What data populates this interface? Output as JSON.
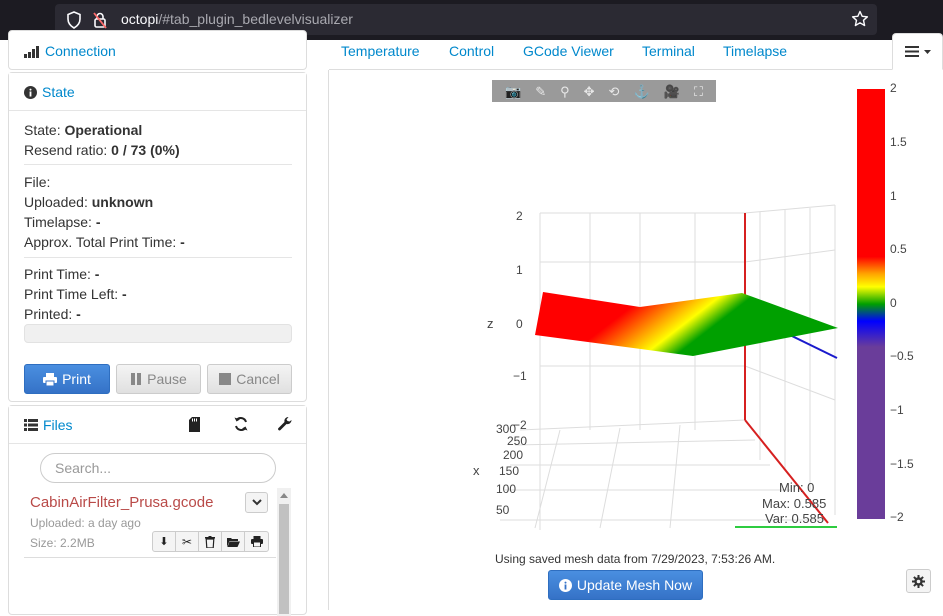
{
  "browser": {
    "url_host": "octopi",
    "url_path": "/#tab_plugin_bedlevelvisualizer"
  },
  "connection": {
    "label": "Connection"
  },
  "state": {
    "title": "State",
    "state_label": "State: ",
    "state_value": "Operational",
    "resend_label": "Resend ratio: ",
    "resend_value": "0 / 73 (0%)",
    "file_label": "File:",
    "uploaded_label": "Uploaded: ",
    "uploaded_value": "unknown",
    "timelapse_label": "Timelapse: ",
    "timelapse_value": "-",
    "approx_label": "Approx. Total Print Time: ",
    "approx_value": "-",
    "print_time_label": "Print Time: ",
    "print_time_value": "-",
    "print_time_left_label": "Print Time Left: ",
    "print_time_left_value": "-",
    "printed_label": "Printed: ",
    "printed_value": "-",
    "progress": 0,
    "buttons": {
      "print": "Print",
      "pause": "Pause",
      "cancel": "Cancel"
    }
  },
  "files": {
    "title": "Files",
    "search_placeholder": "Search...",
    "items": [
      {
        "name": "CabinAirFilter_Prusa.gcode",
        "uploaded": "Uploaded: a day ago",
        "size": "Size: 2.2MB"
      }
    ]
  },
  "tabs": [
    "Temperature",
    "Control",
    "GCode Viewer",
    "Terminal",
    "Timelapse"
  ],
  "plot": {
    "z_label": "z",
    "x_label": "x",
    "z_ticks": [
      "2",
      "1",
      "0",
      "−1",
      "−2"
    ],
    "x_ticks": [
      "300",
      "250",
      "200",
      "150",
      "100",
      "50"
    ],
    "colorbar_ticks": [
      "2",
      "1.5",
      "1",
      "0.5",
      "0",
      "−0.5",
      "−1",
      "−1.5",
      "−2"
    ],
    "stats": {
      "min": "Min: 0",
      "max": "Max: 0.585",
      "var": "Var: 0.585"
    },
    "colors": {
      "high": "#ff0000",
      "orange": "#ffa500",
      "yellow": "#ffff00",
      "green": "#00a000",
      "blue": "#0000ff",
      "low": "#6a3d9a"
    }
  },
  "mesh": {
    "status": "Using saved mesh data from 7/29/2023, 7:53:26 AM.",
    "update_button": "Update Mesh Now"
  }
}
